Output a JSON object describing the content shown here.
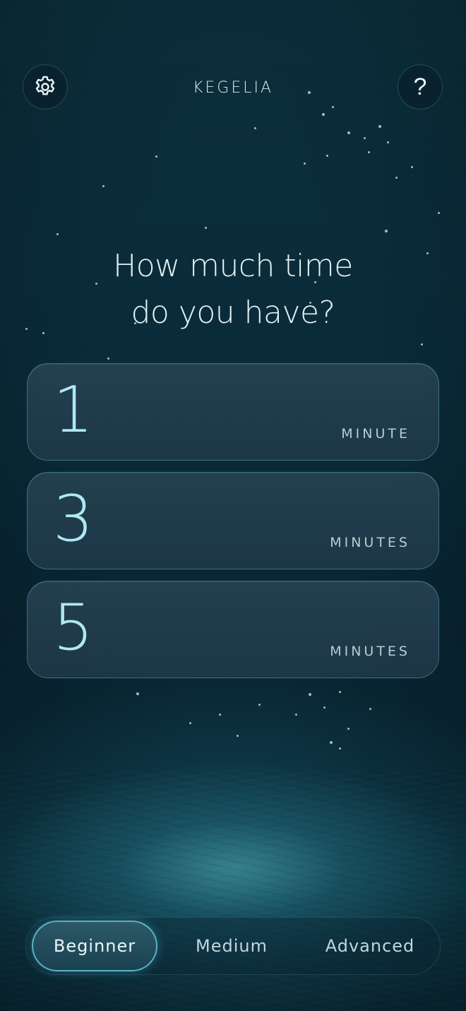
{
  "header": {
    "app_title": "KEGELIA",
    "settings_icon": "gear-icon",
    "help_icon": "question-icon",
    "help_glyph": "?"
  },
  "main": {
    "question_line1": "How much time",
    "question_line2": "do you have?",
    "options": [
      {
        "number": "1",
        "unit": "MINUTE"
      },
      {
        "number": "3",
        "unit": "MINUTES"
      },
      {
        "number": "5",
        "unit": "MINUTES"
      }
    ]
  },
  "levels": {
    "selected": "Beginner",
    "items": [
      "Beginner",
      "Medium",
      "Advanced"
    ]
  },
  "colors": {
    "background": "#0a2633",
    "accent": "#aee8f5",
    "card_border": "#5aaac8"
  }
}
